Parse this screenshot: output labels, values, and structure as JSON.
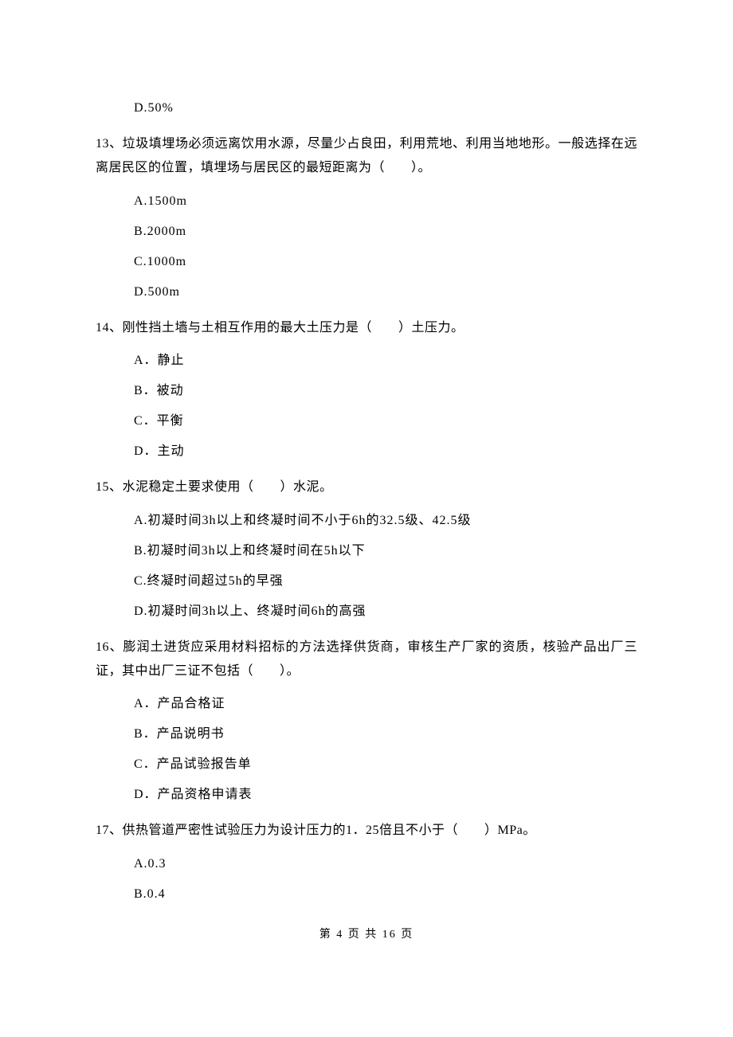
{
  "q12": {
    "option_d": "D.50%"
  },
  "q13": {
    "stem": "13、垃圾填埋场必须远离饮用水源，尽量少占良田，利用荒地、利用当地地形。一般选择在远离居民区的位置，填埋场与居民区的最短距离为（　　）。",
    "a": "A.1500m",
    "b": "B.2000m",
    "c": "C.1000m",
    "d": "D.500m"
  },
  "q14": {
    "stem": "14、刚性挡土墙与土相互作用的最大土压力是（　　）土压力。",
    "a": "A．静止",
    "b": "B．被动",
    "c": "C．平衡",
    "d": "D．主动"
  },
  "q15": {
    "stem": "15、水泥稳定土要求使用（　　）水泥。",
    "a": "A.初凝时间3h以上和终凝时间不小于6h的32.5级、42.5级",
    "b": "B.初凝时间3h以上和终凝时间在5h以下",
    "c": "C.终凝时间超过5h的早强",
    "d": "D.初凝时间3h以上、终凝时间6h的高强"
  },
  "q16": {
    "stem": "16、膨润土进货应采用材料招标的方法选择供货商，审核生产厂家的资质，核验产品出厂三证，其中出厂三证不包括（　　）。",
    "a": "A．产品合格证",
    "b": "B．产品说明书",
    "c": "C．产品试验报告单",
    "d": "D．产品资格申请表"
  },
  "q17": {
    "stem": "17、供热管道严密性试验压力为设计压力的1．25倍且不小于（　　）MPa。",
    "a": "A.0.3",
    "b": "B.0.4"
  },
  "footer": "第 4 页 共 16 页"
}
